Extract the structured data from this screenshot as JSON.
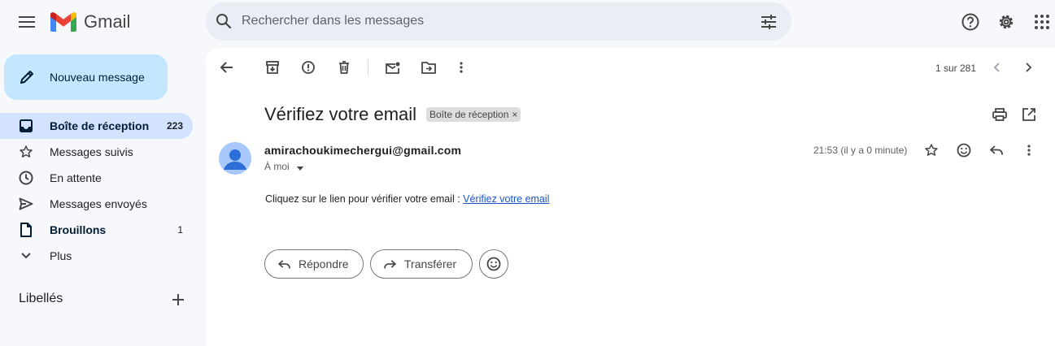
{
  "app": {
    "name": "Gmail"
  },
  "search": {
    "placeholder": "Rechercher dans les messages"
  },
  "compose": {
    "label": "Nouveau message"
  },
  "sidebar": {
    "items": [
      {
        "label": "Boîte de réception",
        "count": "223"
      },
      {
        "label": "Messages suivis",
        "count": ""
      },
      {
        "label": "En attente",
        "count": ""
      },
      {
        "label": "Messages envoyés",
        "count": ""
      },
      {
        "label": "Brouillons",
        "count": "1"
      },
      {
        "label": "Plus",
        "count": ""
      }
    ],
    "labels_title": "Libellés"
  },
  "toolbar": {
    "pager": "1 sur 281"
  },
  "message": {
    "subject": "Vérifiez votre email",
    "label_chip": "Boîte de réception",
    "chip_close": "×",
    "sender": "amirachoukimechergui@gmail.com",
    "to": "À moi",
    "time": "21:53 (il y a 0 minute)",
    "body_prefix": "Cliquez sur le lien pour vérifier votre email : ",
    "body_link": "Vérifiez votre email"
  },
  "actions": {
    "reply": "Répondre",
    "forward": "Transférer"
  },
  "colors": {
    "accent": "#0b57d0",
    "compose_bg": "#c2e7ff",
    "active_nav": "#d3e3fd",
    "link": "#1a56c9"
  },
  "icons": [
    "menu-icon",
    "gmail-logo-icon",
    "search-icon",
    "filter-icon",
    "help-icon",
    "settings-icon",
    "apps-icon",
    "pencil-icon",
    "inbox-icon",
    "star-icon",
    "clock-icon",
    "send-icon",
    "file-icon",
    "chevron-down-icon",
    "plus-icon",
    "back-arrow-icon",
    "archive-icon",
    "report-icon",
    "trash-icon",
    "mark-unread-icon",
    "move-icon",
    "more-icon",
    "chevron-left-icon",
    "chevron-right-icon",
    "print-icon",
    "open-new-window-icon",
    "emoji-icon",
    "reply-icon",
    "forward-icon"
  ]
}
